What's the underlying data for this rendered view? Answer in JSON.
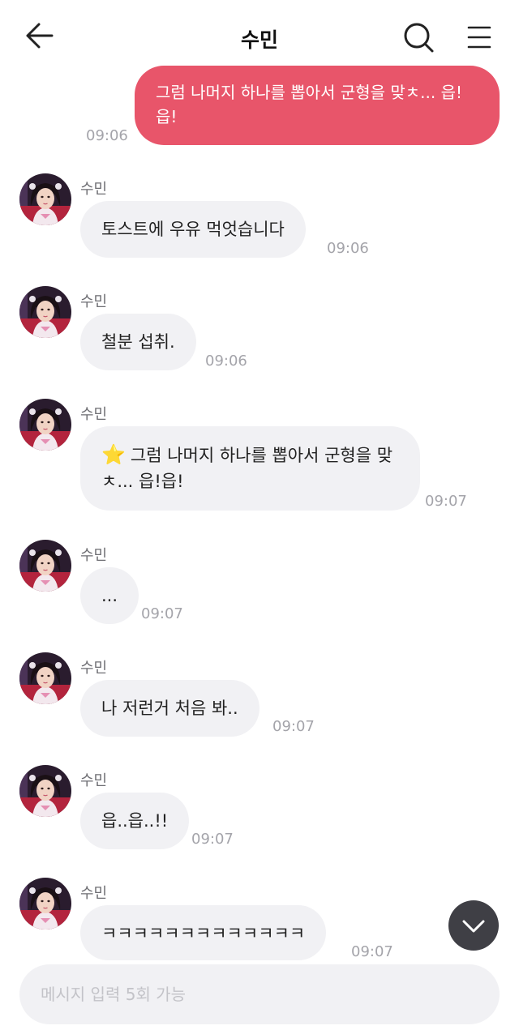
{
  "header": {
    "title": "수민"
  },
  "sent": {
    "text": "그럼 나머지 하나를 뽑아서 군형을 맞ㅊ... 읍!읍!",
    "time": "09:06"
  },
  "messages": [
    {
      "sender": "수민",
      "text": "토스트에 우유 먹엇습니다",
      "time": "09:06"
    },
    {
      "sender": "수민",
      "text": "철분 섭취.",
      "time": "09:06"
    },
    {
      "sender": "수민",
      "star": "⭐",
      "text": "그럼 나머지 하나를 뽑아서 군형을 맞ㅊ... 읍!읍!",
      "time": "09:07"
    },
    {
      "sender": "수민",
      "text": "...",
      "time": "09:07"
    },
    {
      "sender": "수민",
      "text": "나 저런거 처음 봐..",
      "time": "09:07"
    },
    {
      "sender": "수민",
      "text": "읍..읍..!!",
      "time": "09:07"
    },
    {
      "sender": "수민",
      "text": "ㅋㅋㅋㅋㅋㅋㅋㅋㅋㅋㅋㅋㅋ",
      "time": "09:07"
    }
  ],
  "input": {
    "placeholder": "메시지 입력 5회 가능"
  },
  "icons": {
    "back": "arrow-left-icon",
    "search": "search-icon",
    "menu": "hamburger-menu-icon",
    "scroll_down": "chevron-down-icon",
    "star": "star-icon"
  },
  "colors": {
    "sent_bubble": "#e8556a",
    "received_bubble": "#f1f1f4",
    "scroll_button": "#3f3f45",
    "timestamp": "#a4a4aa"
  }
}
